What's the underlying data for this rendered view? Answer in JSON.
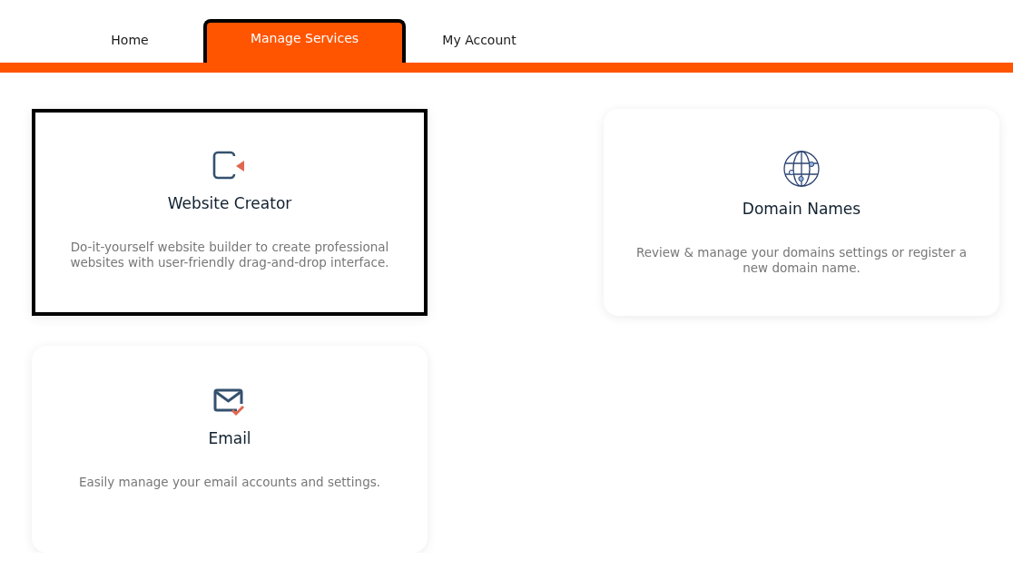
{
  "tabs": [
    {
      "label": "Home",
      "selected": false,
      "focused": false
    },
    {
      "label": "Manage Services",
      "selected": true,
      "focused": true
    },
    {
      "label": "My Account",
      "selected": false,
      "focused": false
    }
  ],
  "services": [
    {
      "kind": "website",
      "title": "Website Creator",
      "description": "Do-it-yourself website builder to create professional websites with user-friendly drag-and-drop interface.",
      "focused": true
    },
    {
      "kind": "domain",
      "title": "Domain Names",
      "description": "Review & manage your domains settings or register a new domain name.",
      "focused": false
    },
    {
      "kind": "email",
      "title": "Email",
      "description": "Easily manage your email accounts and settings.",
      "focused": false
    }
  ]
}
